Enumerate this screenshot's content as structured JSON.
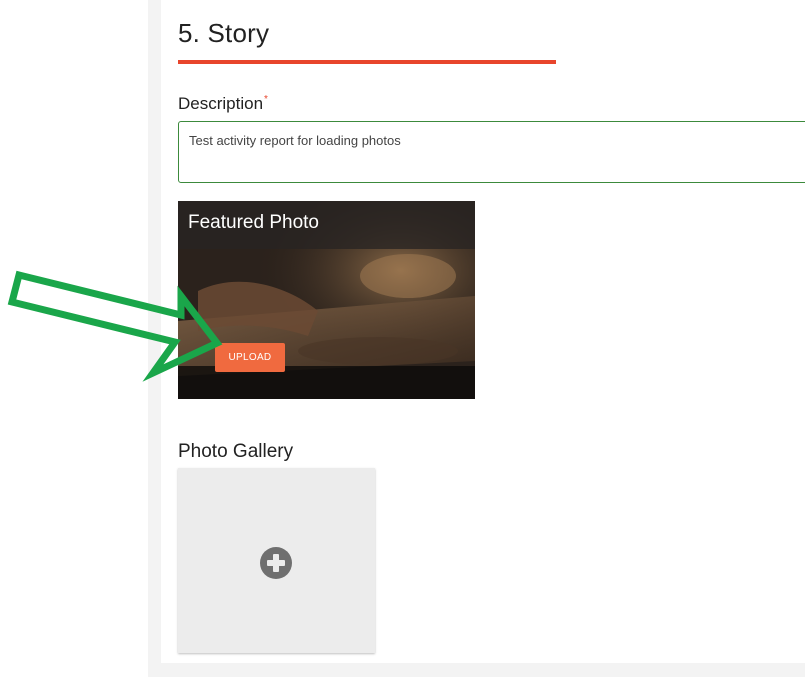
{
  "section": {
    "title": "5. Story"
  },
  "description": {
    "label": "Description",
    "required_marker": "*",
    "value": "Test activity report for loading photos"
  },
  "featured_photo": {
    "title": "Featured Photo",
    "upload_label": "UPLOAD"
  },
  "gallery": {
    "label": "Photo Gallery",
    "add_icon": "plus-circle-icon"
  },
  "colors": {
    "accent": "#e8452c",
    "upload_button": "#f06a3f",
    "field_border": "#3c8a3c",
    "annotation_arrow": "#1aa64a"
  }
}
